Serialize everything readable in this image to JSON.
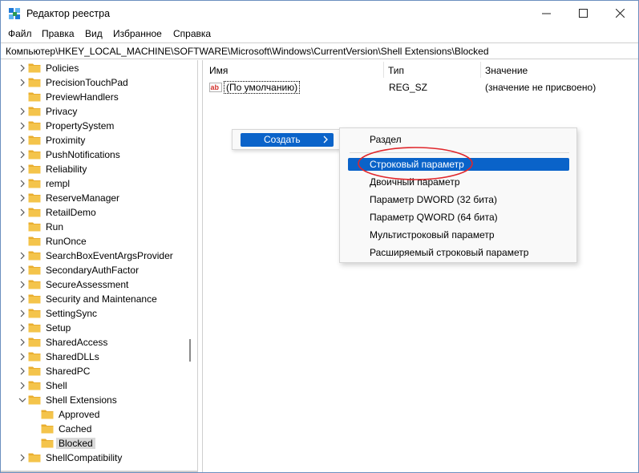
{
  "window": {
    "title": "Редактор реестра"
  },
  "menubar": {
    "items": [
      "Файл",
      "Правка",
      "Вид",
      "Избранное",
      "Справка"
    ]
  },
  "address": {
    "path": "Компьютер\\HKEY_LOCAL_MACHINE\\SOFTWARE\\Microsoft\\Windows\\CurrentVersion\\Shell Extensions\\Blocked"
  },
  "tree": {
    "items": [
      {
        "label": "Policies"
      },
      {
        "label": "PrecisionTouchPad"
      },
      {
        "label": "PreviewHandlers"
      },
      {
        "label": "Privacy"
      },
      {
        "label": "PropertySystem"
      },
      {
        "label": "Proximity"
      },
      {
        "label": "PushNotifications"
      },
      {
        "label": "Reliability"
      },
      {
        "label": "rempl"
      },
      {
        "label": "ReserveManager"
      },
      {
        "label": "RetailDemo"
      },
      {
        "label": "Run"
      },
      {
        "label": "RunOnce"
      },
      {
        "label": "SearchBoxEventArgsProvider"
      },
      {
        "label": "SecondaryAuthFactor"
      },
      {
        "label": "SecureAssessment"
      },
      {
        "label": "Security and Maintenance"
      },
      {
        "label": "SettingSync"
      },
      {
        "label": "Setup"
      },
      {
        "label": "SharedAccess"
      },
      {
        "label": "SharedDLLs"
      },
      {
        "label": "SharedPC"
      },
      {
        "label": "Shell"
      },
      {
        "label": "Shell Extensions"
      },
      {
        "label": "Approved"
      },
      {
        "label": "Cached"
      },
      {
        "label": "Blocked"
      },
      {
        "label": "ShellCompatibility"
      }
    ]
  },
  "list": {
    "columns": {
      "name": "Имя",
      "type": "Тип",
      "data": "Значение"
    },
    "rows": [
      {
        "name": "(По умолчанию)",
        "type": "REG_SZ",
        "data": "(значение не присвоено)"
      }
    ]
  },
  "context_menu": {
    "create_label": "Создать",
    "submenu": [
      "Раздел",
      "Строковый параметр",
      "Двоичный параметр",
      "Параметр DWORD (32 бита)",
      "Параметр QWORD (64 бита)",
      "Мультистроковый параметр",
      "Расширяемый строковый параметр"
    ]
  },
  "colors": {
    "highlight": "#0a63c9",
    "annotation": "#e0262b",
    "folder": "#f4c44b"
  }
}
